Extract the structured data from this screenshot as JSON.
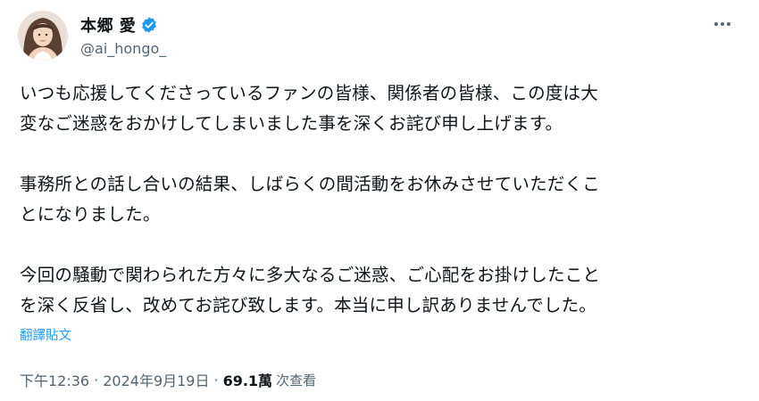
{
  "author": {
    "display_name": "本郷 愛",
    "handle": "@ai_hongo_",
    "verified_icon": "verified-badge-icon",
    "avatar": "profile-photo"
  },
  "more_icon": "more-options-icon",
  "post": {
    "text": "いつも応援してくださっているファンの皆様、関係者の皆様、この度は大\n変なご迷惑をおかけしてしまいました事を深くお詫び申し上げます。\n\n事務所との話し合いの結果、しばらくの間活動をお休みさせていただくこ\nとになりました。\n\n今回の騒動で関わられた方々に多大なるご迷惑、ご心配をお掛けしたこと\nを深く反省し、改めてお詫び致します。本当に申し訳ありませんでした。",
    "translate_label": "翻譯貼文"
  },
  "meta": {
    "time": "下午12:36",
    "separator": "·",
    "date": "2024年9月19日",
    "views_count": "69.1萬",
    "views_label": "次查看"
  },
  "colors": {
    "accent": "#1d9bf0",
    "text": "#0f1419",
    "secondary": "#536471"
  }
}
